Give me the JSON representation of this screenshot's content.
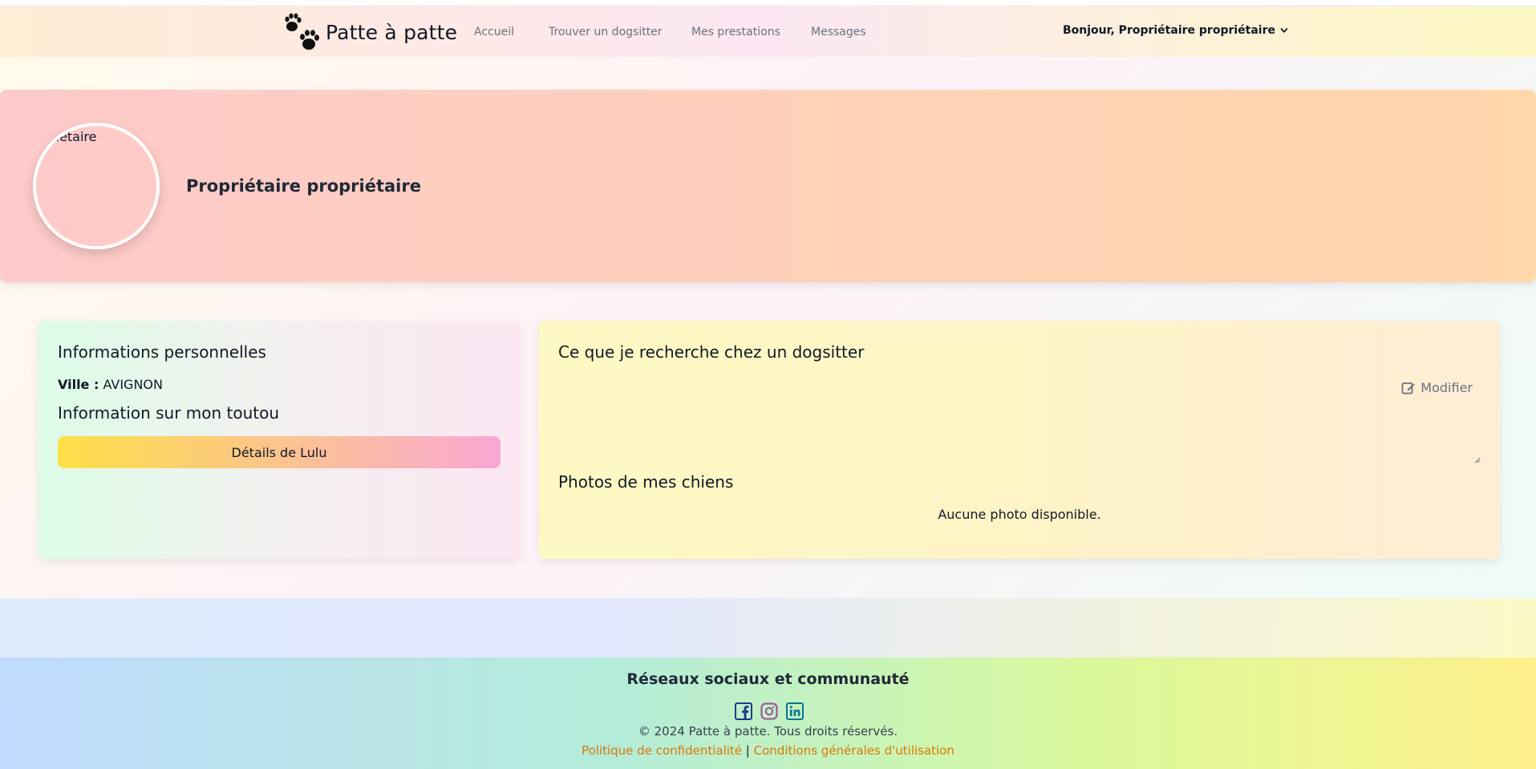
{
  "header": {
    "brand": "Patte à patte",
    "nav": [
      {
        "label": "Accueil"
      },
      {
        "label": "Trouver un dogsitter"
      },
      {
        "label": "Mes prestations"
      },
      {
        "label": "Messages"
      }
    ],
    "user_greeting": "Bonjour, Propriétaire propriétaire",
    "user_menu_icon": "chevron-down-icon"
  },
  "profile": {
    "avatar_alt": "Propriétaire",
    "name": "Propriétaire propriétaire"
  },
  "personal_info": {
    "title": "Informations personnelles",
    "city_label": "Ville :",
    "city_value": "AVIGNON",
    "dog_section_title": "Information sur mon toutou",
    "dog_button": "Détails de Lulu"
  },
  "search": {
    "title": "Ce que je recherche chez un dogsitter",
    "edit_label": "Modifier",
    "description": "",
    "photos_title": "Photos de mes chiens",
    "no_photos": "Aucune photo disponible."
  },
  "footer": {
    "title": "Réseaux sociaux et communauté",
    "socials": [
      {
        "name": "facebook-icon",
        "color": "#1e3a8a"
      },
      {
        "name": "instagram-icon",
        "color": "#9d4e9b"
      },
      {
        "name": "linkedin-icon",
        "color": "#0e7490"
      }
    ],
    "copyright": "© 2024 Patte à patte. Tous droits réservés.",
    "privacy": "Politique de confidentialité",
    "separator": "|",
    "terms": "Conditions générales d'utilisation"
  }
}
